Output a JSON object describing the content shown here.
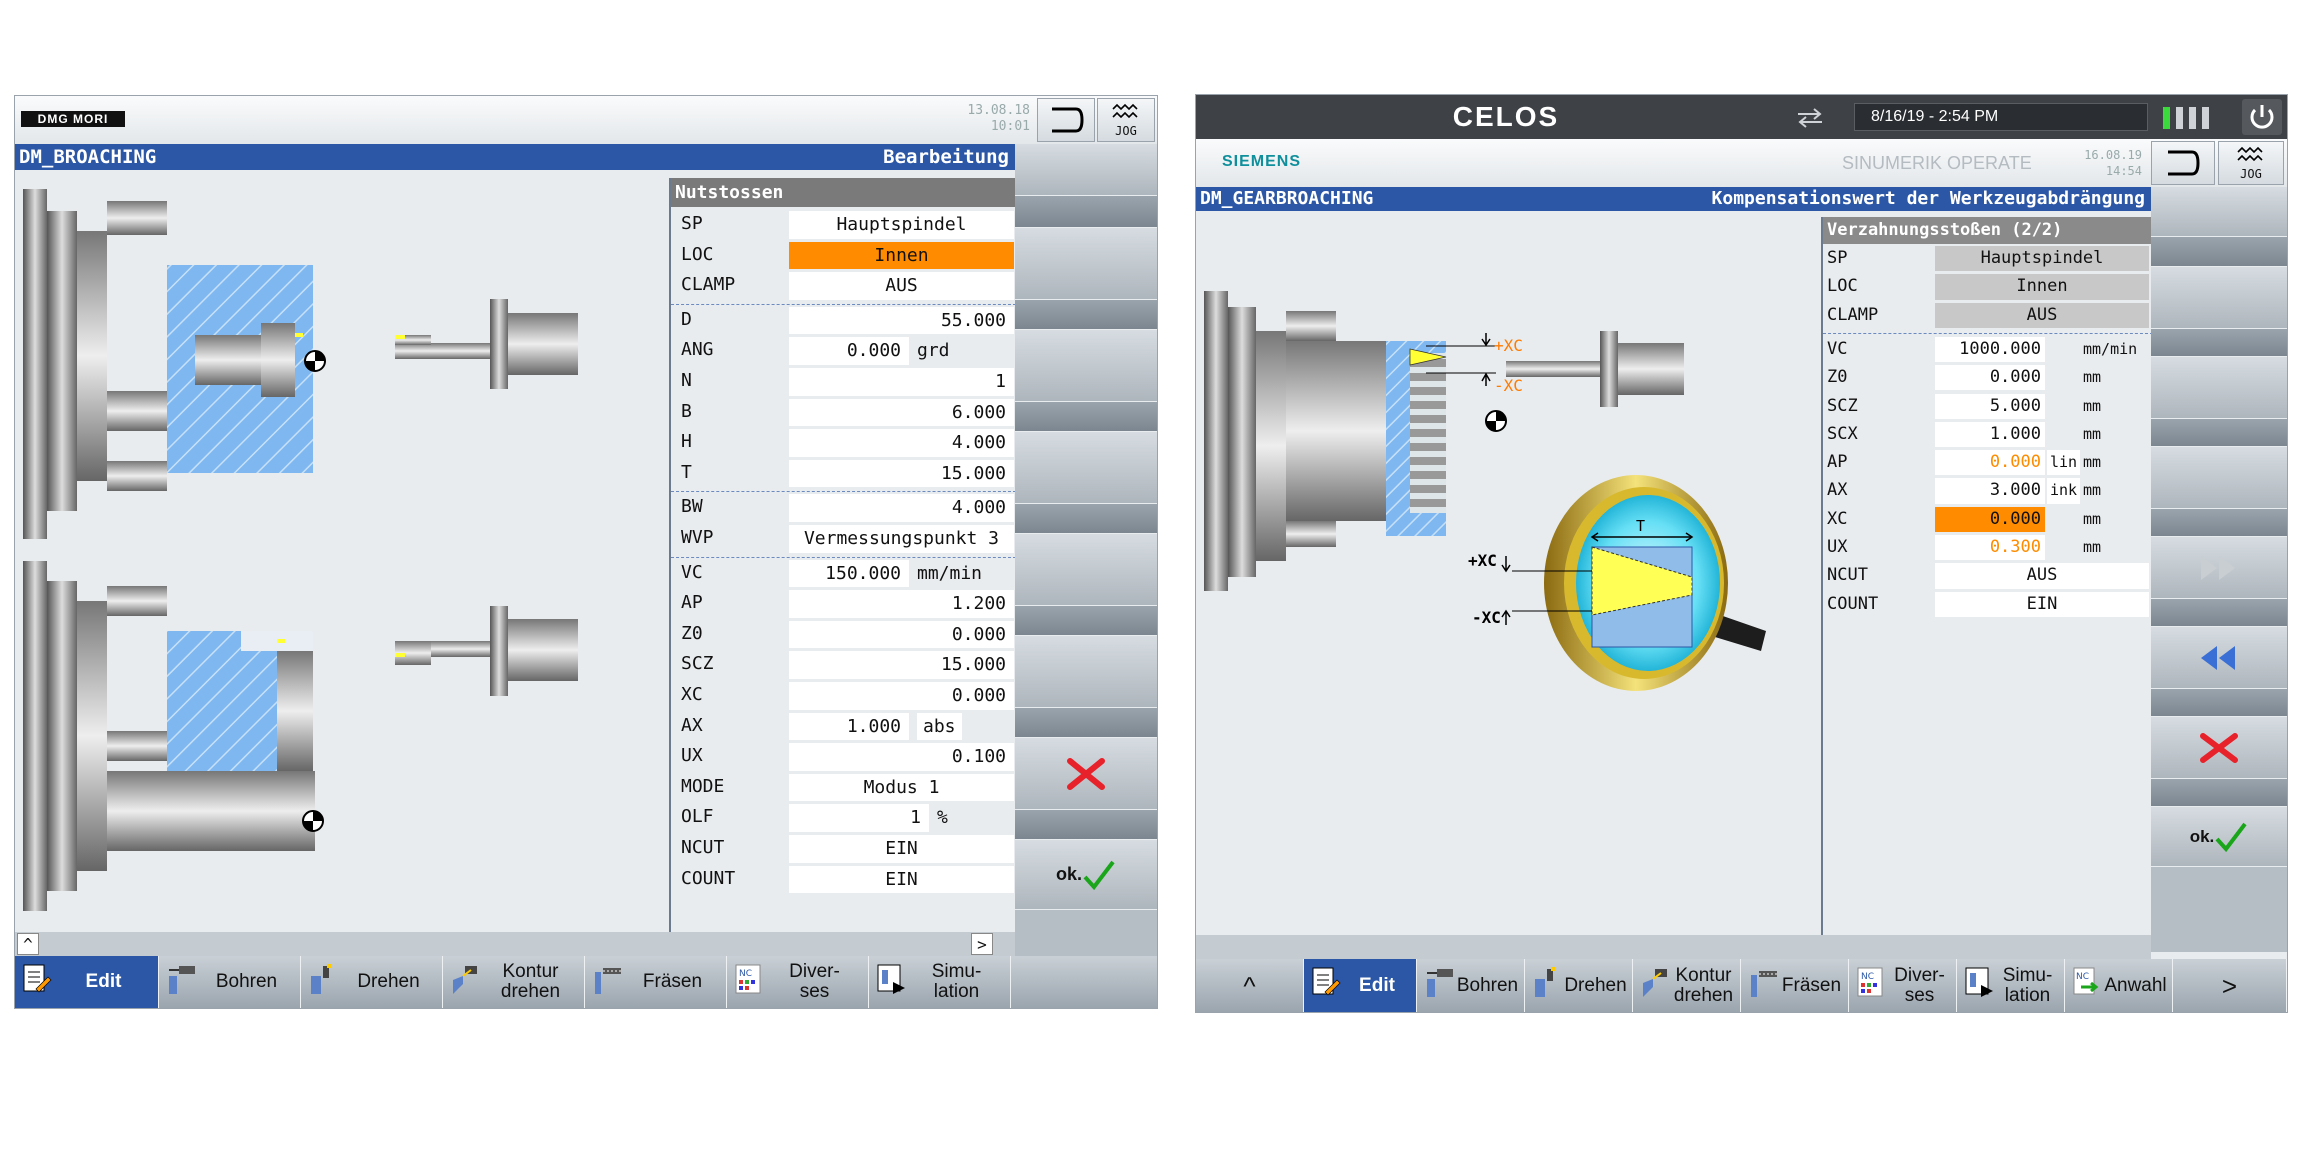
{
  "left": {
    "logo": "DMG MORI",
    "date": "13.08.18",
    "time": "10:01",
    "jog": "JOG",
    "program": "DM_BROACHING",
    "mode": "Bearbeitung",
    "panel": {
      "title": "Nutstossen",
      "rows": [
        {
          "key": "SP",
          "value": "Hauptspindel",
          "unit": ""
        },
        {
          "key": "LOC",
          "value": "Innen",
          "unit": ""
        },
        {
          "key": "CLAMP",
          "value": "AUS",
          "unit": ""
        },
        {
          "key": "D",
          "value": "55.000",
          "unit": ""
        },
        {
          "key": "ANG",
          "value": "0.000",
          "unit": "grd"
        },
        {
          "key": "N",
          "value": "1",
          "unit": ""
        },
        {
          "key": "B",
          "value": "6.000",
          "unit": ""
        },
        {
          "key": "H",
          "value": "4.000",
          "unit": ""
        },
        {
          "key": "T",
          "value": "15.000",
          "unit": ""
        },
        {
          "key": "BW",
          "value": "4.000",
          "unit": ""
        },
        {
          "key": "WVP",
          "value": "Vermessungspunkt 3",
          "unit": ""
        },
        {
          "key": "VC",
          "value": "150.000",
          "unit": "mm/min"
        },
        {
          "key": "AP",
          "value": "1.200",
          "unit": ""
        },
        {
          "key": "Z0",
          "value": "0.000",
          "unit": ""
        },
        {
          "key": "SCZ",
          "value": "15.000",
          "unit": ""
        },
        {
          "key": "XC",
          "value": "0.000",
          "unit": ""
        },
        {
          "key": "AX",
          "value": "1.000",
          "unit": "abs"
        },
        {
          "key": "UX",
          "value": "0.100",
          "unit": ""
        },
        {
          "key": "MODE",
          "value": "Modus 1",
          "unit": ""
        },
        {
          "key": "OLF",
          "value": "1",
          "unit": "%"
        },
        {
          "key": "NCUT",
          "value": "EIN",
          "unit": ""
        },
        {
          "key": "COUNT",
          "value": "EIN",
          "unit": ""
        }
      ]
    },
    "softkeys": {
      "ok": "ok."
    },
    "bottom": [
      {
        "label": "Edit"
      },
      {
        "label": "Bohren"
      },
      {
        "label": "Drehen"
      },
      {
        "label": "Kontur drehen"
      },
      {
        "label": "Fräsen"
      },
      {
        "label": "Diver- ses"
      },
      {
        "label": "Simu- lation"
      }
    ],
    "scroll_left": "^",
    "scroll_right": ">"
  },
  "right": {
    "brand": "CELOS",
    "datetime": "8/16/19 - 2:54 PM",
    "siemens": "SIEMENS",
    "product": "SINUMERIK OPERATE",
    "date": "16.08.19",
    "time": "14:54",
    "jog": "JOG",
    "program": "DM_GEARBROACHING",
    "mode": "Kompensationswert der Werkzeugabdrängung",
    "labels": {
      "plus_xc": "+XC",
      "minus_xc": "-XC",
      "t": "T"
    },
    "panel": {
      "title": "Verzahnungsstoßen (2/2)",
      "rows": [
        {
          "key": "SP",
          "value": "Hauptspindel",
          "unit": "",
          "mod": ""
        },
        {
          "key": "LOC",
          "value": "Innen",
          "unit": "",
          "mod": ""
        },
        {
          "key": "CLAMP",
          "value": "AUS",
          "unit": "",
          "mod": ""
        },
        {
          "key": "VC",
          "value": "1000.000",
          "unit": "mm/min",
          "mod": ""
        },
        {
          "key": "Z0",
          "value": "0.000",
          "unit": "mm",
          "mod": ""
        },
        {
          "key": "SCZ",
          "value": "5.000",
          "unit": "mm",
          "mod": ""
        },
        {
          "key": "SCX",
          "value": "1.000",
          "unit": "mm",
          "mod": ""
        },
        {
          "key": "AP",
          "value": "0.000",
          "unit": "mm",
          "mod": "lin"
        },
        {
          "key": "AX",
          "value": "3.000",
          "unit": "mm",
          "mod": "ink"
        },
        {
          "key": "XC",
          "value": "0.000",
          "unit": "mm",
          "mod": ""
        },
        {
          "key": "UX",
          "value": "0.300",
          "unit": "mm",
          "mod": ""
        },
        {
          "key": "NCUT",
          "value": "AUS",
          "unit": "",
          "mod": ""
        },
        {
          "key": "COUNT",
          "value": "EIN",
          "unit": "",
          "mod": ""
        }
      ]
    },
    "softkeys": {
      "ok": "ok."
    },
    "bottom": [
      {
        "label": "^"
      },
      {
        "label": "Edit"
      },
      {
        "label": "Bohren"
      },
      {
        "label": "Drehen"
      },
      {
        "label": "Kontur drehen"
      },
      {
        "label": "Fräsen"
      },
      {
        "label": "Diver- ses"
      },
      {
        "label": "Simu- lation"
      },
      {
        "label": "Anwahl"
      },
      {
        "label": ">"
      }
    ],
    "colors": {
      "accent": "#2c57a6",
      "highlight": "#ff8c00",
      "orange_text": "#ff8c00"
    }
  }
}
